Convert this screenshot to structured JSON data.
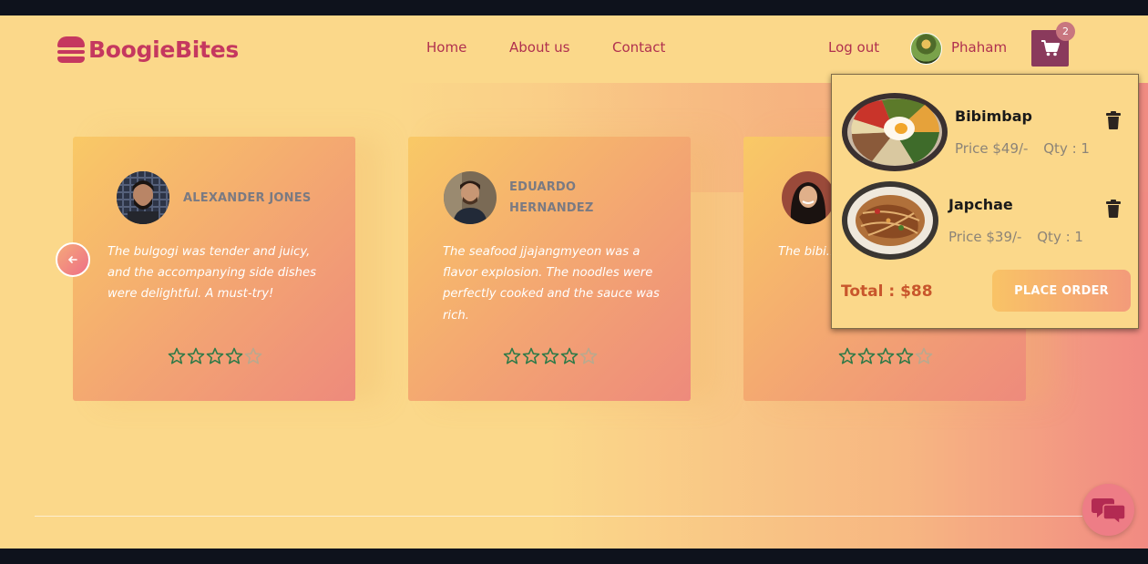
{
  "brand": {
    "name": "BoogieBites",
    "icon": "burger-icon"
  },
  "nav": {
    "home": "Home",
    "about": "About us",
    "contact": "Contact"
  },
  "user": {
    "logout": "Log out",
    "name": "Phaham"
  },
  "cart": {
    "count": "2",
    "icon": "shopping-cart-icon"
  },
  "testimonials": [
    {
      "name_lines": [
        "ALEXANDER JONES"
      ],
      "quote": "The bulgogi was tender and juicy, and the accompanying side dishes were delightful. A must-try!",
      "rating": 4,
      "max_rating": 5
    },
    {
      "name_lines": [
        "EDUARDO",
        "HERNANDEZ"
      ],
      "quote": "The seafood jjajangmyeon was a flavor explosion. The noodles were perfectly cooked and the sauce was rich.",
      "rating": 4,
      "max_rating": 5
    },
    {
      "name_lines": [
        ""
      ],
      "quote": "The bibi... flavors, a... perfect l...",
      "rating": 4,
      "max_rating": 5
    }
  ],
  "carousel": {
    "prev_icon": "arrow-left-icon"
  },
  "cart_dropdown": {
    "items": [
      {
        "name": "Bibimbap",
        "price": "Price $49/-",
        "qty": "Qty : 1"
      },
      {
        "name": "Japchae",
        "price": "Price $39/-",
        "qty": "Qty : 1"
      }
    ],
    "total": "Total : $88",
    "place_order": "PLACE ORDER"
  },
  "chat": {
    "icon": "chat-bubbles-icon"
  },
  "colors": {
    "brand": "#c5385f",
    "accent": "#8a3a5c",
    "background": "#fbd88a",
    "star": "#2f7a48"
  }
}
